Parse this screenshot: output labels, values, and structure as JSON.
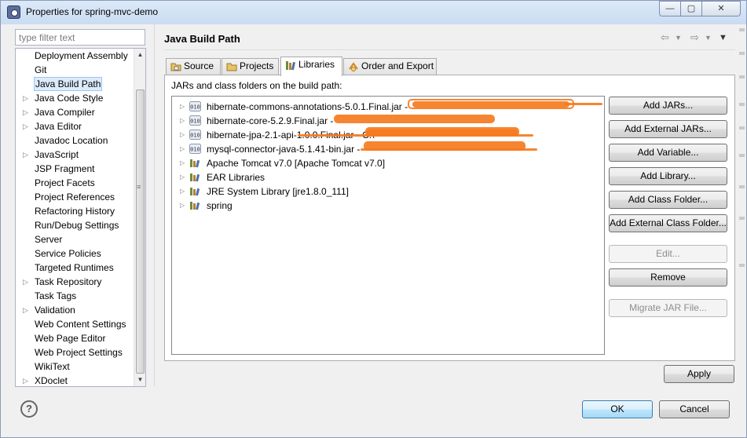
{
  "window": {
    "title": "Properties for spring-mvc-demo",
    "controls": {
      "minimize": "—",
      "maximize": "▢",
      "close": "✕"
    }
  },
  "filter": {
    "placeholder": "type filter text"
  },
  "nav": {
    "items": [
      {
        "label": "Deployment Assembly",
        "expandable": false
      },
      {
        "label": "Git",
        "expandable": false
      },
      {
        "label": "Java Build Path",
        "expandable": false,
        "selected": true
      },
      {
        "label": "Java Code Style",
        "expandable": true
      },
      {
        "label": "Java Compiler",
        "expandable": true
      },
      {
        "label": "Java Editor",
        "expandable": true
      },
      {
        "label": "Javadoc Location",
        "expandable": false
      },
      {
        "label": "JavaScript",
        "expandable": true
      },
      {
        "label": "JSP Fragment",
        "expandable": false
      },
      {
        "label": "Project Facets",
        "expandable": false
      },
      {
        "label": "Project References",
        "expandable": false
      },
      {
        "label": "Refactoring History",
        "expandable": false
      },
      {
        "label": "Run/Debug Settings",
        "expandable": false
      },
      {
        "label": "Server",
        "expandable": false
      },
      {
        "label": "Service Policies",
        "expandable": false
      },
      {
        "label": "Targeted Runtimes",
        "expandable": false
      },
      {
        "label": "Task Repository",
        "expandable": true
      },
      {
        "label": "Task Tags",
        "expandable": false
      },
      {
        "label": "Validation",
        "expandable": true
      },
      {
        "label": "Web Content Settings",
        "expandable": false
      },
      {
        "label": "Web Page Editor",
        "expandable": false
      },
      {
        "label": "Web Project Settings",
        "expandable": false
      },
      {
        "label": "WikiText",
        "expandable": false
      },
      {
        "label": "XDoclet",
        "expandable": true
      }
    ]
  },
  "page": {
    "title": "Java Build Path",
    "tabs": [
      {
        "label": "Source",
        "icon": "source-folder-icon"
      },
      {
        "label": "Projects",
        "icon": "projects-icon"
      },
      {
        "label": "Libraries",
        "icon": "libraries-icon",
        "active": true
      },
      {
        "label": "Order and Export",
        "icon": "order-export-icon"
      }
    ],
    "caption": "JARs and class folders on the build path:",
    "libraries": [
      {
        "label": "hibernate-commons-annotations-5.0.1.Final.jar -",
        "icon": "jar-icon"
      },
      {
        "label": "hibernate-core-5.2.9.Final.jar -",
        "icon": "jar-icon"
      },
      {
        "label": "hibernate-jpa-2.1-api-1.0.0.Final.jar - C:\\",
        "icon": "jar-icon"
      },
      {
        "label": "mysql-connector-java-5.1.41-bin.jar -",
        "icon": "jar-icon"
      },
      {
        "label": "Apache Tomcat v7.0 [Apache Tomcat v7.0]",
        "icon": "library-icon"
      },
      {
        "label": "EAR Libraries",
        "icon": "library-icon"
      },
      {
        "label": "JRE System Library [jre1.8.0_111]",
        "icon": "library-icon"
      },
      {
        "label": "spring",
        "icon": "library-icon"
      }
    ],
    "buttons": {
      "add_jars": "Add JARs...",
      "add_external_jars": "Add External JARs...",
      "add_variable": "Add Variable...",
      "add_library": "Add Library...",
      "add_class_folder": "Add Class Folder...",
      "add_external_class_folder": "Add External Class Folder...",
      "edit": "Edit...",
      "remove": "Remove",
      "migrate_jar": "Migrate JAR File..."
    },
    "apply": "Apply"
  },
  "footer": {
    "help": "?",
    "ok": "OK",
    "cancel": "Cancel"
  },
  "colors": {
    "scribble": "#f57b20",
    "selection": "#dcebfc",
    "default_button": "#a7d9f5"
  }
}
